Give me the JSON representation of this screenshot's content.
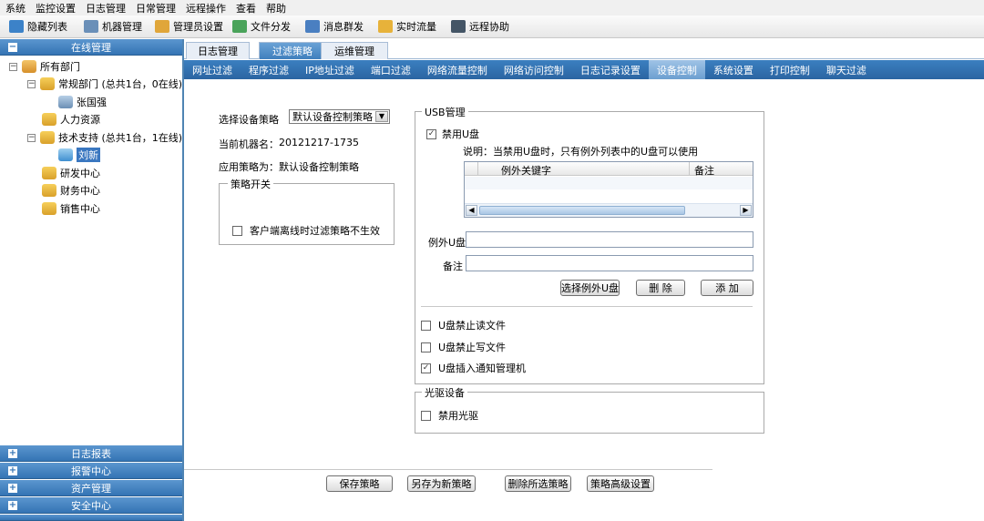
{
  "menu": [
    "系统",
    "监控设置",
    "日志管理",
    "日常管理",
    "远程操作",
    "查看",
    "帮助"
  ],
  "toolbar": {
    "items": [
      {
        "label": "隐藏列表",
        "icon": "list-icon",
        "color": "#3c82c8"
      },
      {
        "label": "机器管理",
        "icon": "computer-icon",
        "color": "#6a8fb8"
      },
      {
        "label": "管理员设置",
        "icon": "admin-users-icon",
        "color": "#e0a63a"
      },
      {
        "label": "文件分发",
        "icon": "file-distribute-icon",
        "color": "#4aa35a"
      },
      {
        "label": "消息群发",
        "icon": "message-icon",
        "color": "#4a7fc1"
      },
      {
        "label": "实时流量",
        "icon": "traffic-icon",
        "color": "#e7b23a"
      },
      {
        "label": "远程协助",
        "icon": "remote-screen-icon",
        "color": "#445566"
      }
    ]
  },
  "sidebar": {
    "header": "在线管理",
    "tree": {
      "root": "所有部门",
      "nodes": [
        {
          "label": "常规部门 (总共1台，0在线)"
        },
        {
          "label": "张国强"
        },
        {
          "label": "人力资源"
        },
        {
          "label": "技术支持 (总共1台，1在线)"
        },
        {
          "label": "刘新"
        },
        {
          "label": "研发中心"
        },
        {
          "label": "财务中心"
        },
        {
          "label": "销售中心"
        }
      ]
    },
    "sections": [
      "日志报表",
      "报警中心",
      "资产管理",
      "安全中心"
    ]
  },
  "tabs1": [
    "日志管理",
    "过滤策略",
    "运维管理"
  ],
  "tabs2": [
    "网址过滤",
    "程序过滤",
    "IP地址过滤",
    "端口过滤",
    "网络流量控制",
    "网络访问控制",
    "日志记录设置",
    "设备控制",
    "系统设置",
    "打印控制",
    "聊天过滤"
  ],
  "left": {
    "select_label": "选择设备策略",
    "select_value": "默认设备控制策略",
    "machine_label": "当前机器名：",
    "machine_value": "20121217-1735",
    "policy_label": "应用策略为：",
    "policy_value": "默认设备控制策略",
    "switch_title": "策略开关",
    "switch_option": "客户端离线时过滤策略不生效"
  },
  "usb": {
    "title": "USB管理",
    "disable_label": "禁用U盘",
    "note": "说明：当禁用U盘时，只有例外列表中的U盘可以使用",
    "col1": "例外关键字",
    "col2": "备注",
    "exception_label": "例外U盘",
    "remark_label": "备注",
    "btn_select": "选择例外U盘",
    "btn_delete": "删 除",
    "btn_add": "添 加",
    "opt_read": "U盘禁止读文件",
    "opt_write": "U盘禁止写文件",
    "opt_notify": "U盘插入通知管理机"
  },
  "optical": {
    "title": "光驱设备",
    "disable_label": "禁用光驱"
  },
  "bottom": [
    "保存策略",
    "另存为新策略",
    "删除所选策略",
    "策略高级设置"
  ]
}
